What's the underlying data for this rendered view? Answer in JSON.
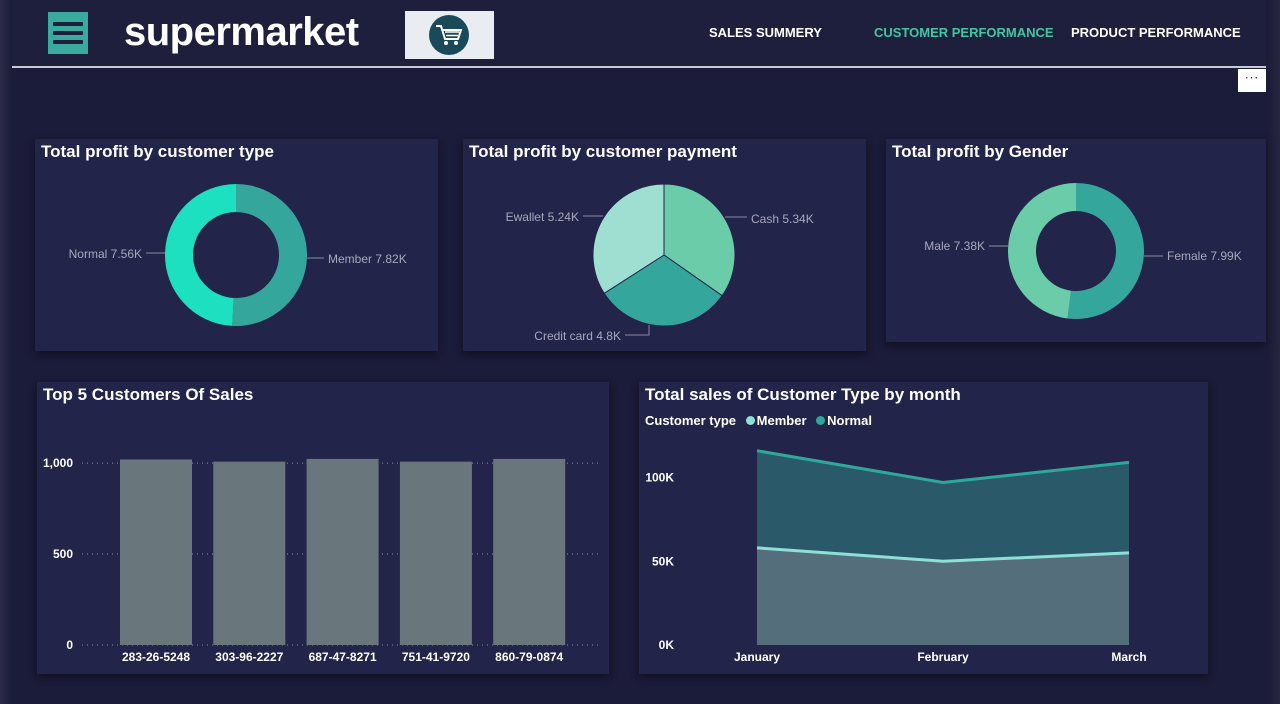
{
  "header": {
    "logo": "supermarket",
    "nav": [
      "SALES SUMMERY",
      "CUSTOMER PERFORMANCE",
      "PRODUCT PERFORMANCE"
    ],
    "active_nav": "CUSTOMER PERFORMANCE",
    "more_label": "···"
  },
  "colors": {
    "background": "#1b1b3a",
    "card": "#23244a",
    "accent": "#3fc7a3",
    "teal": "#35a69c",
    "bright_teal": "#1de0c0",
    "light_teal": "#6acca8",
    "pale_teal": "#9fdfd2",
    "bar": "#69777d"
  },
  "chart_data": [
    {
      "type": "pie",
      "variant": "donut",
      "title": "Total profit by customer type",
      "slices": [
        {
          "label": "Member",
          "value": 7.82,
          "display": "Member 7.82K",
          "color": "#35a69c"
        },
        {
          "label": "Normal",
          "value": 7.56,
          "display": "Normal 7.56K",
          "color": "#1de0c0"
        }
      ]
    },
    {
      "type": "pie",
      "title": "Total profit by customer payment",
      "slices": [
        {
          "label": "Cash",
          "value": 5.34,
          "display": "Cash 5.34K",
          "color": "#6acca8"
        },
        {
          "label": "Credit card",
          "value": 4.8,
          "display": "Credit card 4.8K",
          "color": "#35a69c"
        },
        {
          "label": "Ewallet",
          "value": 5.24,
          "display": "Ewallet 5.24K",
          "color": "#9fdfd2"
        }
      ]
    },
    {
      "type": "pie",
      "variant": "donut",
      "title": "Total profit by Gender",
      "slices": [
        {
          "label": "Female",
          "value": 7.99,
          "display": "Female 7.99K",
          "color": "#35a69c"
        },
        {
          "label": "Male",
          "value": 7.38,
          "display": "Male 7.38K",
          "color": "#6acca8"
        }
      ]
    },
    {
      "type": "bar",
      "title": "Top 5 Customers Of Sales",
      "categories": [
        "283-26-5248",
        "303-96-2227",
        "687-47-8271",
        "751-41-9720",
        "860-79-0874"
      ],
      "values": [
        1020,
        1008,
        1023,
        1008,
        1023
      ],
      "ylim": [
        0,
        1050
      ],
      "yticks": [
        0,
        500,
        1000
      ],
      "ytick_labels": [
        "0",
        "500",
        "1,000"
      ],
      "grid": true
    },
    {
      "type": "area",
      "title": "Total sales of Customer Type by month",
      "legend_title": "Customer type",
      "legend_placement": "top-left",
      "categories": [
        "January",
        "February",
        "March"
      ],
      "series": [
        {
          "name": "Member",
          "values": [
            58000,
            50000,
            55000
          ],
          "color": "#8ee0d6"
        },
        {
          "name": "Normal",
          "values": [
            58000,
            47000,
            54000
          ],
          "color": "#2fa89c"
        }
      ],
      "ylim": [
        0,
        120000
      ],
      "yticks": [
        0,
        50000,
        100000
      ],
      "ytick_labels": [
        "0K",
        "50K",
        "100K"
      ]
    }
  ]
}
